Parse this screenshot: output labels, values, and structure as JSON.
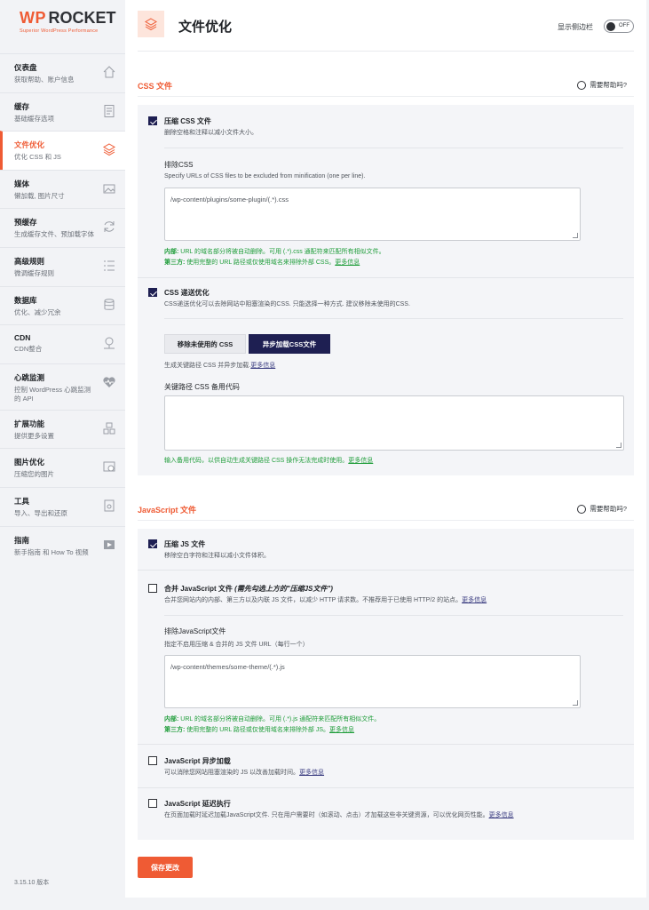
{
  "brand": {
    "wp": "WP",
    "rocket": "ROCKET",
    "tagline": "Superior WordPress Performance"
  },
  "sidebar": {
    "items": [
      {
        "title": "仪表盘",
        "subtitle": "获取帮助、账户信息",
        "icon": "home-icon"
      },
      {
        "title": "缓存",
        "subtitle": "基础缓存选项",
        "icon": "document-icon"
      },
      {
        "title": "文件优化",
        "subtitle": "优化 CSS 和 JS",
        "icon": "layers-icon"
      },
      {
        "title": "媒体",
        "subtitle": "懒加载, 图片尺寸",
        "icon": "image-icon"
      },
      {
        "title": "预缓存",
        "subtitle": "生成缓存文件、预加载字体",
        "icon": "refresh-icon"
      },
      {
        "title": "高级规则",
        "subtitle": "微调缓存规则",
        "icon": "list-icon"
      },
      {
        "title": "数据库",
        "subtitle": "优化、减少冗余",
        "icon": "database-icon"
      },
      {
        "title": "CDN",
        "subtitle": "CDN整合",
        "icon": "cdn-icon"
      },
      {
        "title": "心跳监测",
        "subtitle": "控制 WordPress 心跳监测的 API",
        "icon": "heartbeat-icon"
      },
      {
        "title": "扩展功能",
        "subtitle": "提供更多设置",
        "icon": "addons-icon"
      },
      {
        "title": "图片优化",
        "subtitle": "压缩您的图片",
        "icon": "image-optimize-icon"
      },
      {
        "title": "工具",
        "subtitle": "导入、导出和还原",
        "icon": "tools-icon"
      },
      {
        "title": "指南",
        "subtitle": "新手指南 和 How To 视频",
        "icon": "video-icon"
      }
    ],
    "version": "3.15.10 版本"
  },
  "header": {
    "title": "文件优化",
    "toggle_label": "显示侧边栏",
    "toggle_state": "OFF"
  },
  "css_section": {
    "title": "CSS 文件",
    "help": "需要帮助吗?",
    "minify": {
      "title": "压缩 CSS 文件",
      "desc": "删除空格和注释以减小文件大小。",
      "checked": true
    },
    "exclude": {
      "title": "排除CSS",
      "desc": "Specify URLs of CSS files to be excluded from minification (one per line).",
      "placeholder": "/wp-content/plugins/some-plugin/(.*).css",
      "note1_label": "内部:",
      "note1_text": " URL 的域名部分将被自动删除。可用 (.*).css 通配符来匹配所有相似文件。",
      "note2_label": "第三方:",
      "note2_text": " 使用完整的 URL 路径或仅使用域名来排除外部 CSS。",
      "more": "更多信息"
    },
    "optimize": {
      "title": "CSS 递送优化",
      "desc": "CSS递送优化可以去除网站中阻塞渲染的CSS. 只能选择一种方式. 建议移除未使用的CSS.",
      "checked": true
    },
    "buttons": {
      "remove_unused": "移除未使用的 CSS",
      "async": "异步加载CSS文件"
    },
    "async_desc": "生成关键路径 CSS 并异步加载.",
    "async_more": "更多信息",
    "fallback_title": "关键路径 CSS 备用代码",
    "fallback_note": "输入备用代码，以供自动生成关键路径 CSS 操作无法完成时使用。",
    "fallback_more": "更多信息"
  },
  "js_section": {
    "title": "JavaScript 文件",
    "help": "需要帮助吗?",
    "minify": {
      "title": "压缩 JS 文件",
      "desc": "移除空白字符和注释以减小文件体积。",
      "checked": true
    },
    "combine": {
      "title": "合并 JavaScript 文件",
      "title_hint": "(需先勾选上方的\"压缩JS文件\")",
      "desc": "合并您网站内的内部、第三方以及内联 JS 文件，以减少 HTTP 请求数。不推荐用于已使用 HTTP/2 的站点。",
      "more": "更多信息",
      "checked": false
    },
    "exclude": {
      "title": "排除JavaScript文件",
      "desc": "指定不启用压缩 & 合并的 JS 文件 URL（每行一个）",
      "placeholder": "/wp-content/themes/some-theme/(.*).js",
      "note1_label": "内部:",
      "note1_text": " URL 的域名部分将被自动删除。可用 (.*).js 通配符来匹配所有相似文件。",
      "note2_label": "第三方:",
      "note2_text": " 使用完整的 URL 路径或仅使用域名来排除外部 JS。",
      "more": "更多信息"
    },
    "async": {
      "title": "JavaScript 异步加载",
      "desc": "可以消除您网站阻塞渲染的 JS 以改善加载时间。",
      "more": "更多信息",
      "checked": false
    },
    "defer": {
      "title": "JavaScript 延迟执行",
      "desc": "在页面加载时延迟加载JavaScript文件. 只在用户需要时（如滚动、点击）才加载这些非关键资源，可以优化网页性能。",
      "more": "更多信息",
      "checked": false
    }
  },
  "save_button": "保存更改",
  "colors": {
    "accent": "#ef5b34",
    "primary": "#1e1f52",
    "success": "#1f9d3a"
  }
}
